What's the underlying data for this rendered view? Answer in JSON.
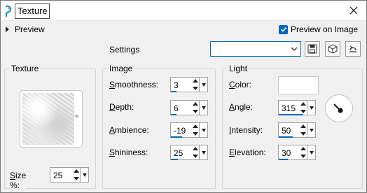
{
  "window": {
    "title": "Texture"
  },
  "preview": {
    "label": "Preview",
    "preview_on_image_label": "Preview on Image",
    "preview_on_image_checked": true
  },
  "settings": {
    "label": "Settings",
    "selected_value": "",
    "icons": [
      "save-icon",
      "manage-presets-icon",
      "reset-icon"
    ]
  },
  "texture_group": {
    "label": "Texture",
    "size_label": "Size %:",
    "size_value": "25"
  },
  "image_group": {
    "label": "Image",
    "smoothness_label": "Smoothness:",
    "smoothness_value": "3",
    "smoothness_level": 0.0,
    "depth_label": "Depth:",
    "depth_value": "6",
    "depth_level": 0.2,
    "ambience_label": "Ambience:",
    "ambience_value": "-19",
    "ambience_level": 0.4,
    "shininess_label": "Shininess:",
    "shininess_value": "25",
    "shininess_level": 0.25
  },
  "light_group": {
    "label": "Light",
    "color_label": "Color:",
    "color_value": "#ffffff",
    "angle_label": "Angle:",
    "angle_value": "315",
    "angle_level": 0.875,
    "intensity_label": "Intensity:",
    "intensity_value": "50",
    "intensity_level": 0.5,
    "elevation_label": "Elevation:",
    "elevation_value": "30",
    "elevation_level": 0.33
  },
  "colors": {
    "accent": "#0067c0",
    "window_bg": "#f0f0f0"
  }
}
